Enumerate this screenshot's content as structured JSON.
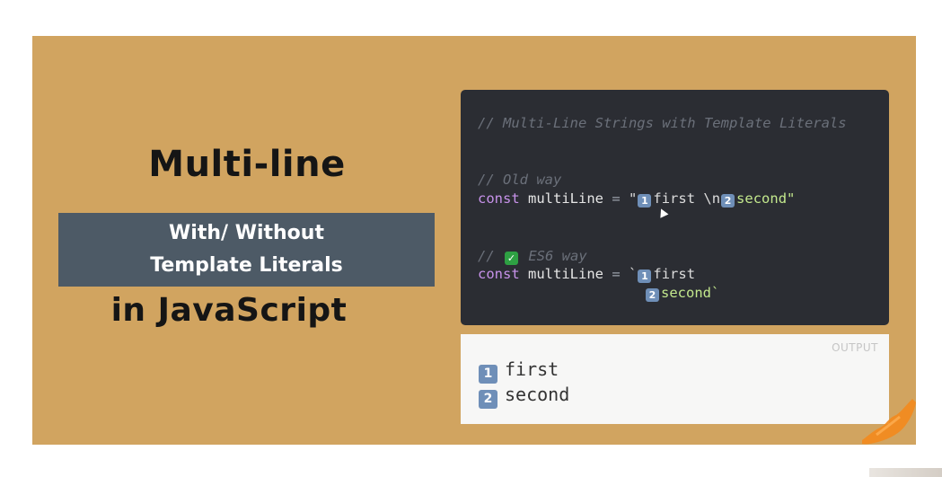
{
  "slide": {
    "title_top": "Multi-line",
    "band_line1": "With/ Without",
    "band_line2": "Template Literals",
    "title_bottom": "in JavaScript"
  },
  "code": {
    "comment_header": "// Multi-Line Strings with Template Literals",
    "comment_old": "// Old way",
    "comment_es6_prefix": "//",
    "comment_es6_suffix": " ES6 way",
    "check_icon": "check-mark-button-icon",
    "kw_const": "const",
    "ident_name": "multiLine",
    "op_eq": "=",
    "old_quote_open": "\"",
    "old_first": "first \\n",
    "old_second": "second\"",
    "es6_backtick_open": "`",
    "es6_first": "first",
    "es6_second": "second`",
    "keycap_one": "1",
    "keycap_two": "2"
  },
  "output": {
    "label": "OUTPUT",
    "line1": "first",
    "line2": "second",
    "keycap_one": "1",
    "keycap_two": "2"
  },
  "colors": {
    "slide_bg": "#d1a460",
    "band_bg": "#4d5a66",
    "code_bg": "#2b2d33",
    "keyword": "#c792ea",
    "comment": "#6b707a",
    "output_bg": "#f7f7f6",
    "brush_accent": "#f28a1e"
  }
}
